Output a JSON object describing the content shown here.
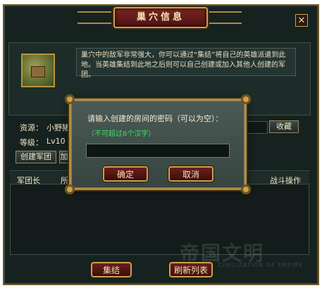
{
  "window": {
    "title": "巢穴信息",
    "close_label": "✕"
  },
  "info": {
    "description": "巢穴中的敌军非常强大，你可以通过“集结”将自己的英雄派遣到此地。当英雄集结到此地之后则可以自己创建或加入其他人创建的军团。",
    "resource_label": "资源：",
    "resource_value": "小野猪",
    "level_label": "等级：",
    "level_value": "Lv10",
    "exchange_button": "收藏",
    "create_legion_button": "创建军团",
    "join_button_partial": "加"
  },
  "list": {
    "columns": [
      "军团长",
      "所",
      "战斗操作"
    ]
  },
  "footer": {
    "gather_button": "集结",
    "refresh_button": "刷新列表"
  },
  "watermark": {
    "text": "帝国文明",
    "sub": "CIVILIZATION OF EMPIRE"
  },
  "modal": {
    "prompt": "请输入创建的房间的密码（可以为空）：",
    "hint": "（不可超过6个汉字）",
    "input_value": "",
    "confirm_button": "确定",
    "cancel_button": "取消"
  },
  "colors": {
    "frame_gold": "#c9a24e",
    "panel_bg": "#15221f",
    "button_red": "#6a1f1f",
    "hint_green": "#35e06a"
  }
}
